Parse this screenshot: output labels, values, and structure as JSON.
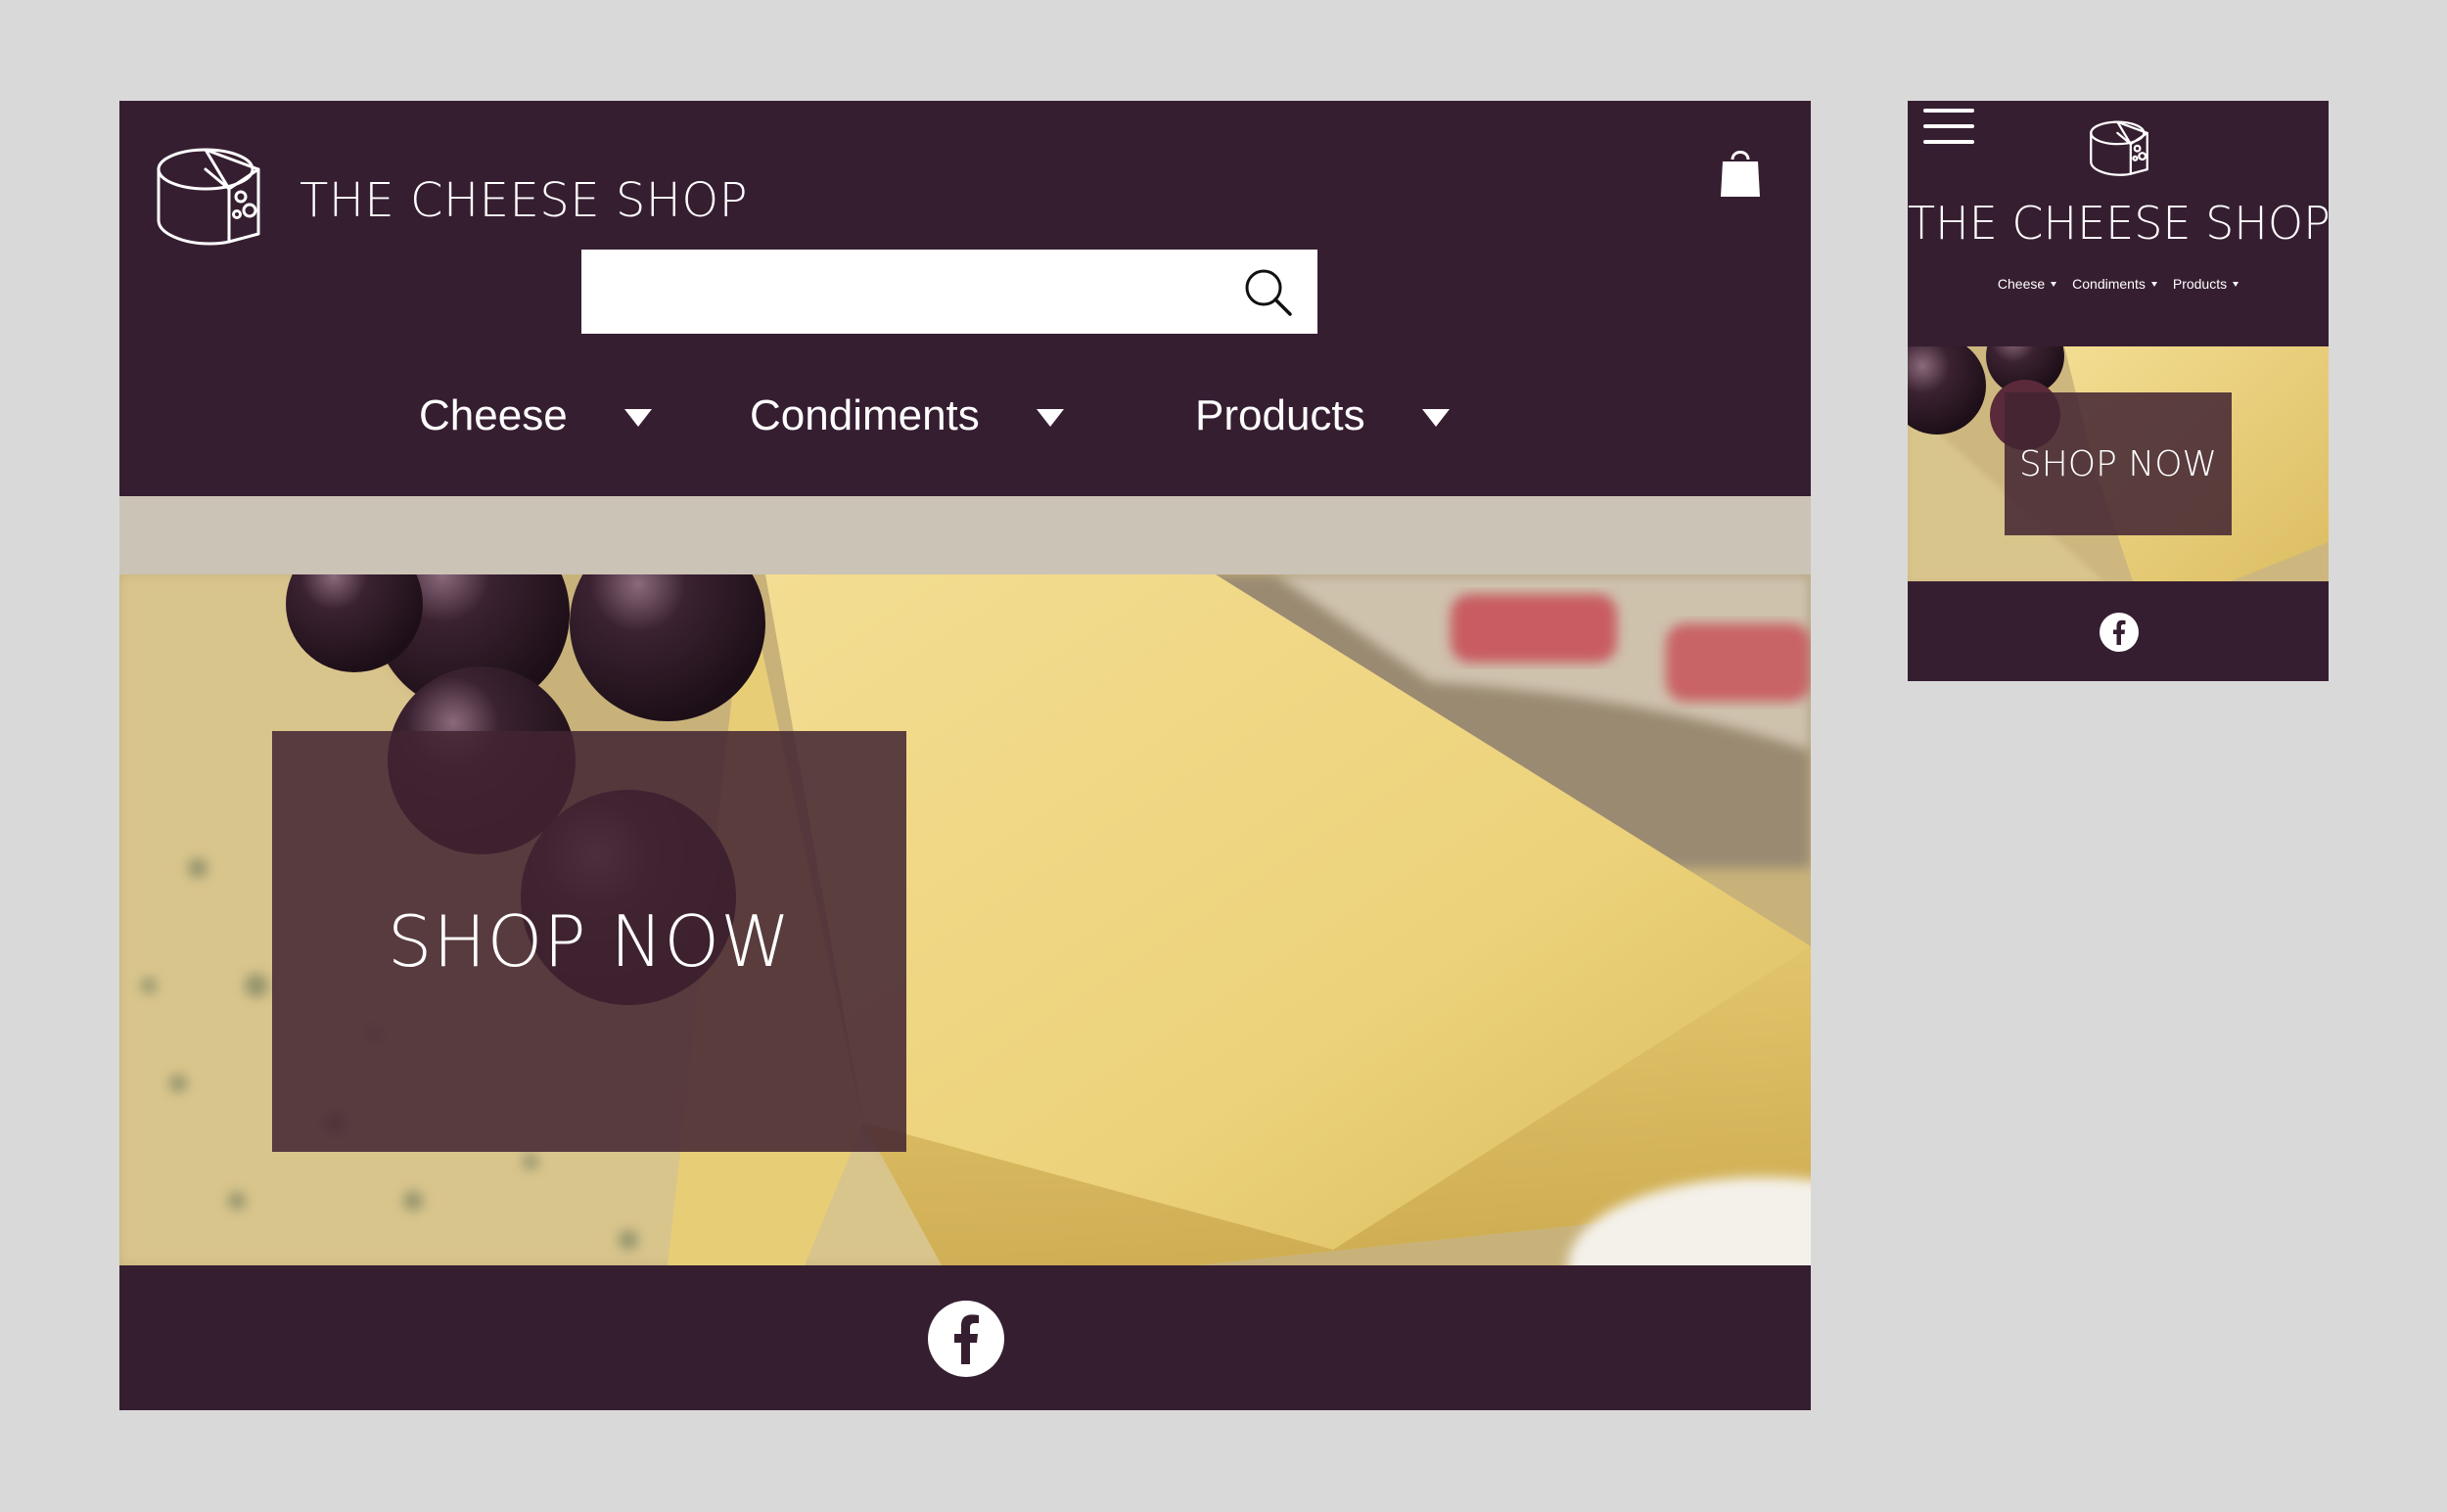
{
  "desktop": {
    "title": "THE CHEESE SHOP",
    "search": {
      "value": "",
      "placeholder": ""
    },
    "nav": [
      {
        "label": "Cheese"
      },
      {
        "label": "Condiments"
      },
      {
        "label": "Products"
      }
    ],
    "cta": "SHOP NOW",
    "footer": {
      "social": "facebook-icon"
    }
  },
  "mobile": {
    "title": "THE CHEESE SHOP",
    "nav": [
      {
        "label": "Cheese"
      },
      {
        "label": "Condiments"
      },
      {
        "label": "Products"
      }
    ],
    "cta": "SHOP NOW",
    "footer": {
      "social": "facebook-icon"
    }
  },
  "colors": {
    "page_background": "#d9d9d9",
    "header": "#361e31",
    "band": "#cbc3b6",
    "overlay": "#42243299",
    "text": "#ffffff"
  }
}
